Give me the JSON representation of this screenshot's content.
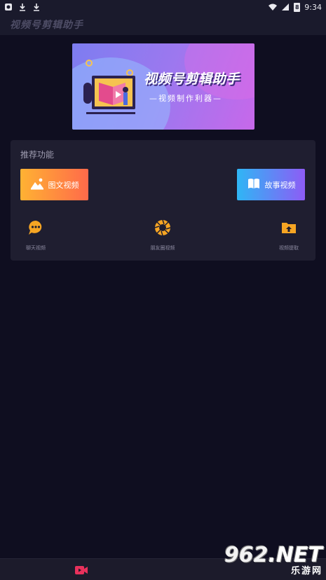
{
  "status_bar": {
    "time": "9:34",
    "battery": "8"
  },
  "app": {
    "title": "视频号剪辑助手"
  },
  "banner": {
    "title": "视频号剪辑助手",
    "subtitle": "—视频制作利器—"
  },
  "recommend": {
    "title": "推荐功能",
    "primary": [
      {
        "label": "图文视频",
        "icon": "image-icon",
        "color": "#ff8a3d"
      },
      {
        "label": "故事视频",
        "icon": "book-icon",
        "color": "#5a8df5"
      }
    ],
    "secondary": [
      {
        "label": "聊天视频",
        "icon": "chat-bubble-icon"
      },
      {
        "label": "朋友圈视频",
        "icon": "aperture-icon"
      },
      {
        "label": "视频提取",
        "icon": "folder-upload-icon"
      }
    ]
  },
  "bottom_nav": {
    "active_icon": "video-camera-icon",
    "accent": "#e8315c"
  },
  "watermark": {
    "main_prefix": "962",
    "main_suffix": ".NET",
    "sub": "乐游网"
  }
}
